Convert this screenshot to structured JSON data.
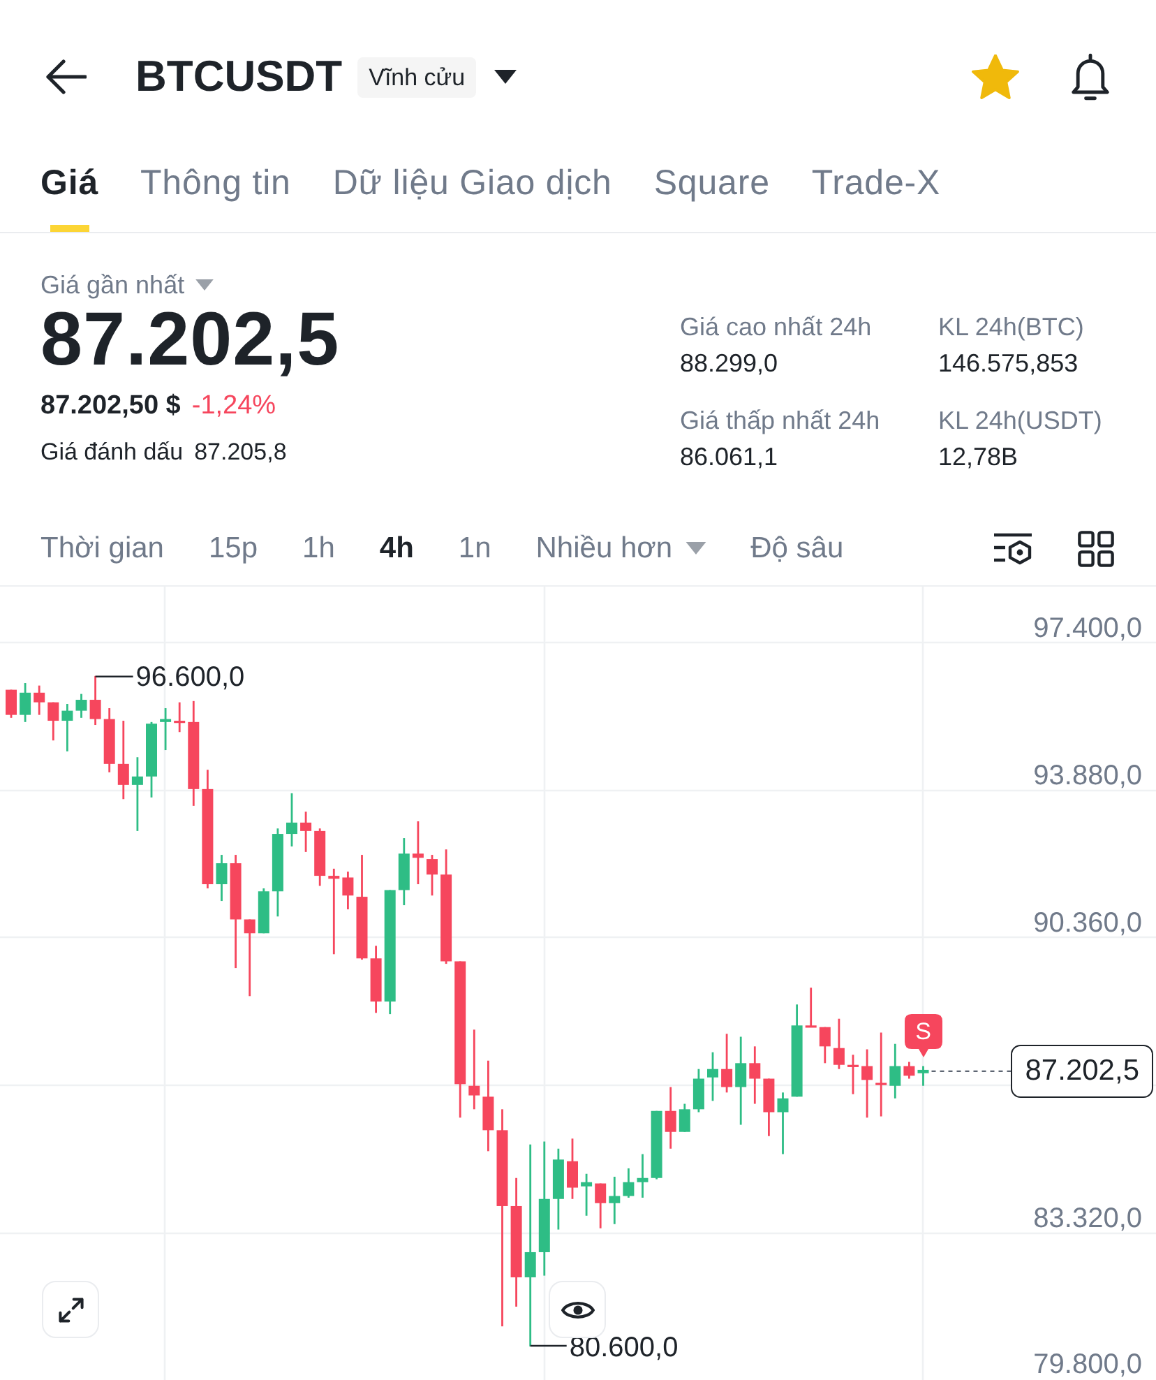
{
  "header": {
    "symbol": "BTCUSDT",
    "contract_type": "Vĩnh cửu",
    "favorite": true
  },
  "tabs": [
    {
      "label": "Giá",
      "selected": true
    },
    {
      "label": "Thông tin",
      "selected": false
    },
    {
      "label": "Dữ liệu Giao dịch",
      "selected": false
    },
    {
      "label": "Square",
      "selected": false
    },
    {
      "label": "Trade-X",
      "selected": false
    }
  ],
  "price": {
    "label": "Giá gần nhất",
    "last_price": "87.202,5",
    "usd_value": "87.202,50 $",
    "change": "-1,24%",
    "falling": true,
    "mark_price_label": "Giá đánh dấu",
    "mark_price": "87.205,8"
  },
  "stats": [
    {
      "label": "Giá cao nhất 24h",
      "value": "88.299,0"
    },
    {
      "label": "KL 24h(BTC)",
      "value": "146.575,853"
    },
    {
      "label": "Giá thấp nhất 24h",
      "value": "86.061,1"
    },
    {
      "label": "KL 24h(USDT)",
      "value": "12,78B"
    }
  ],
  "intervals": [
    {
      "label": "Thời gian",
      "kind": "option",
      "selected": false
    },
    {
      "label": "15p",
      "kind": "option",
      "selected": false
    },
    {
      "label": "1h",
      "kind": "option",
      "selected": false
    },
    {
      "label": "4h",
      "kind": "option",
      "selected": true
    },
    {
      "label": "1n",
      "kind": "option",
      "selected": false
    },
    {
      "label": "Nhiều hơn",
      "kind": "dropdown",
      "selected": false
    },
    {
      "label": "Độ sâu",
      "kind": "option",
      "selected": false
    }
  ],
  "chart": {
    "chart_data": {
      "type": "candlestick",
      "grid": true,
      "ohlc": [
        [
          96270,
          96270,
          95600,
          95670
        ],
        [
          95670,
          96430,
          95500,
          96200
        ],
        [
          96200,
          96370,
          95670,
          95970
        ],
        [
          95970,
          95970,
          95060,
          95530
        ],
        [
          95530,
          95930,
          94800,
          95770
        ],
        [
          95770,
          96170,
          95600,
          96030
        ],
        [
          96030,
          96600,
          95430,
          95570
        ],
        [
          95570,
          95830,
          94300,
          94500
        ],
        [
          94500,
          95530,
          93660,
          94000
        ],
        [
          94000,
          94660,
          92900,
          94200
        ],
        [
          94200,
          95500,
          93700,
          95460
        ],
        [
          95500,
          95830,
          94830,
          95570
        ],
        [
          95530,
          95970,
          95260,
          95500
        ],
        [
          95500,
          96000,
          93500,
          93900
        ],
        [
          93900,
          94360,
          91530,
          91630
        ],
        [
          91630,
          92330,
          91230,
          92130
        ],
        [
          92130,
          92330,
          89630,
          90790
        ],
        [
          90790,
          90790,
          88960,
          90460
        ],
        [
          90460,
          91530,
          90460,
          91460
        ],
        [
          91460,
          92960,
          90860,
          92830
        ],
        [
          92830,
          93800,
          92530,
          93100
        ],
        [
          93100,
          93360,
          92400,
          92900
        ],
        [
          92900,
          92960,
          91590,
          91830
        ],
        [
          91830,
          92000,
          89960,
          91760
        ],
        [
          91790,
          91930,
          91030,
          91360
        ],
        [
          91330,
          92330,
          89830,
          89860
        ],
        [
          89860,
          90160,
          88560,
          88830
        ],
        [
          88830,
          91490,
          88530,
          91490
        ],
        [
          91490,
          92730,
          91130,
          92360
        ],
        [
          92360,
          93130,
          91630,
          92260
        ],
        [
          92230,
          92330,
          91360,
          91860
        ],
        [
          91860,
          92460,
          89730,
          89790
        ],
        [
          89790,
          89790,
          86060,
          86860
        ],
        [
          86820,
          88160,
          86260,
          86590
        ],
        [
          86560,
          87420,
          85260,
          85760
        ],
        [
          85760,
          86260,
          81080,
          83950
        ],
        [
          83950,
          84620,
          81550,
          82250
        ],
        [
          82250,
          85420,
          80600,
          82850
        ],
        [
          82850,
          85490,
          82290,
          84120
        ],
        [
          84120,
          85320,
          83390,
          85060
        ],
        [
          85020,
          85560,
          84120,
          84390
        ],
        [
          84420,
          84720,
          83720,
          84520
        ],
        [
          84490,
          84490,
          83420,
          84020
        ],
        [
          84020,
          84650,
          83520,
          84190
        ],
        [
          84190,
          84850,
          84150,
          84520
        ],
        [
          84520,
          85190,
          84150,
          84620
        ],
        [
          84620,
          86220,
          84590,
          86220
        ],
        [
          86220,
          86790,
          85320,
          85720
        ],
        [
          85720,
          86390,
          85720,
          86260
        ],
        [
          86260,
          87220,
          86190,
          86990
        ],
        [
          87020,
          87620,
          86460,
          87220
        ],
        [
          87220,
          88060,
          86660,
          86790
        ],
        [
          86790,
          87990,
          85890,
          87360
        ],
        [
          87360,
          87760,
          86390,
          86990
        ],
        [
          86990,
          86990,
          85620,
          86190
        ],
        [
          86190,
          86660,
          85190,
          86520
        ],
        [
          86560,
          88760,
          86560,
          88260
        ],
        [
          88260,
          89160,
          88220,
          88220
        ],
        [
          88220,
          88220,
          87360,
          87760
        ],
        [
          87720,
          88420,
          87220,
          87320
        ],
        [
          87320,
          87560,
          86620,
          87290
        ],
        [
          87290,
          87690,
          86060,
          86960
        ],
        [
          86890,
          88090,
          86090,
          86860
        ],
        [
          86820,
          87820,
          86520,
          87290
        ],
        [
          87290,
          87390,
          86990,
          87060
        ],
        [
          87120,
          87290,
          86820,
          87200
        ]
      ],
      "ylim": [
        79800,
        98730
      ],
      "yticks": [
        {
          "value": 97400,
          "label": "97.400,0"
        },
        {
          "value": 93880,
          "label": "93.880,0"
        },
        {
          "value": 90360,
          "label": "90.360,0"
        },
        {
          "value": 83320,
          "label": "83.320,0"
        },
        {
          "value": 79800,
          "label": "79.800,0"
        }
      ]
    },
    "high_label": "96.600,0",
    "low_label": "80.600,0",
    "current_price": "87.202,5",
    "trade_marker": "S"
  }
}
